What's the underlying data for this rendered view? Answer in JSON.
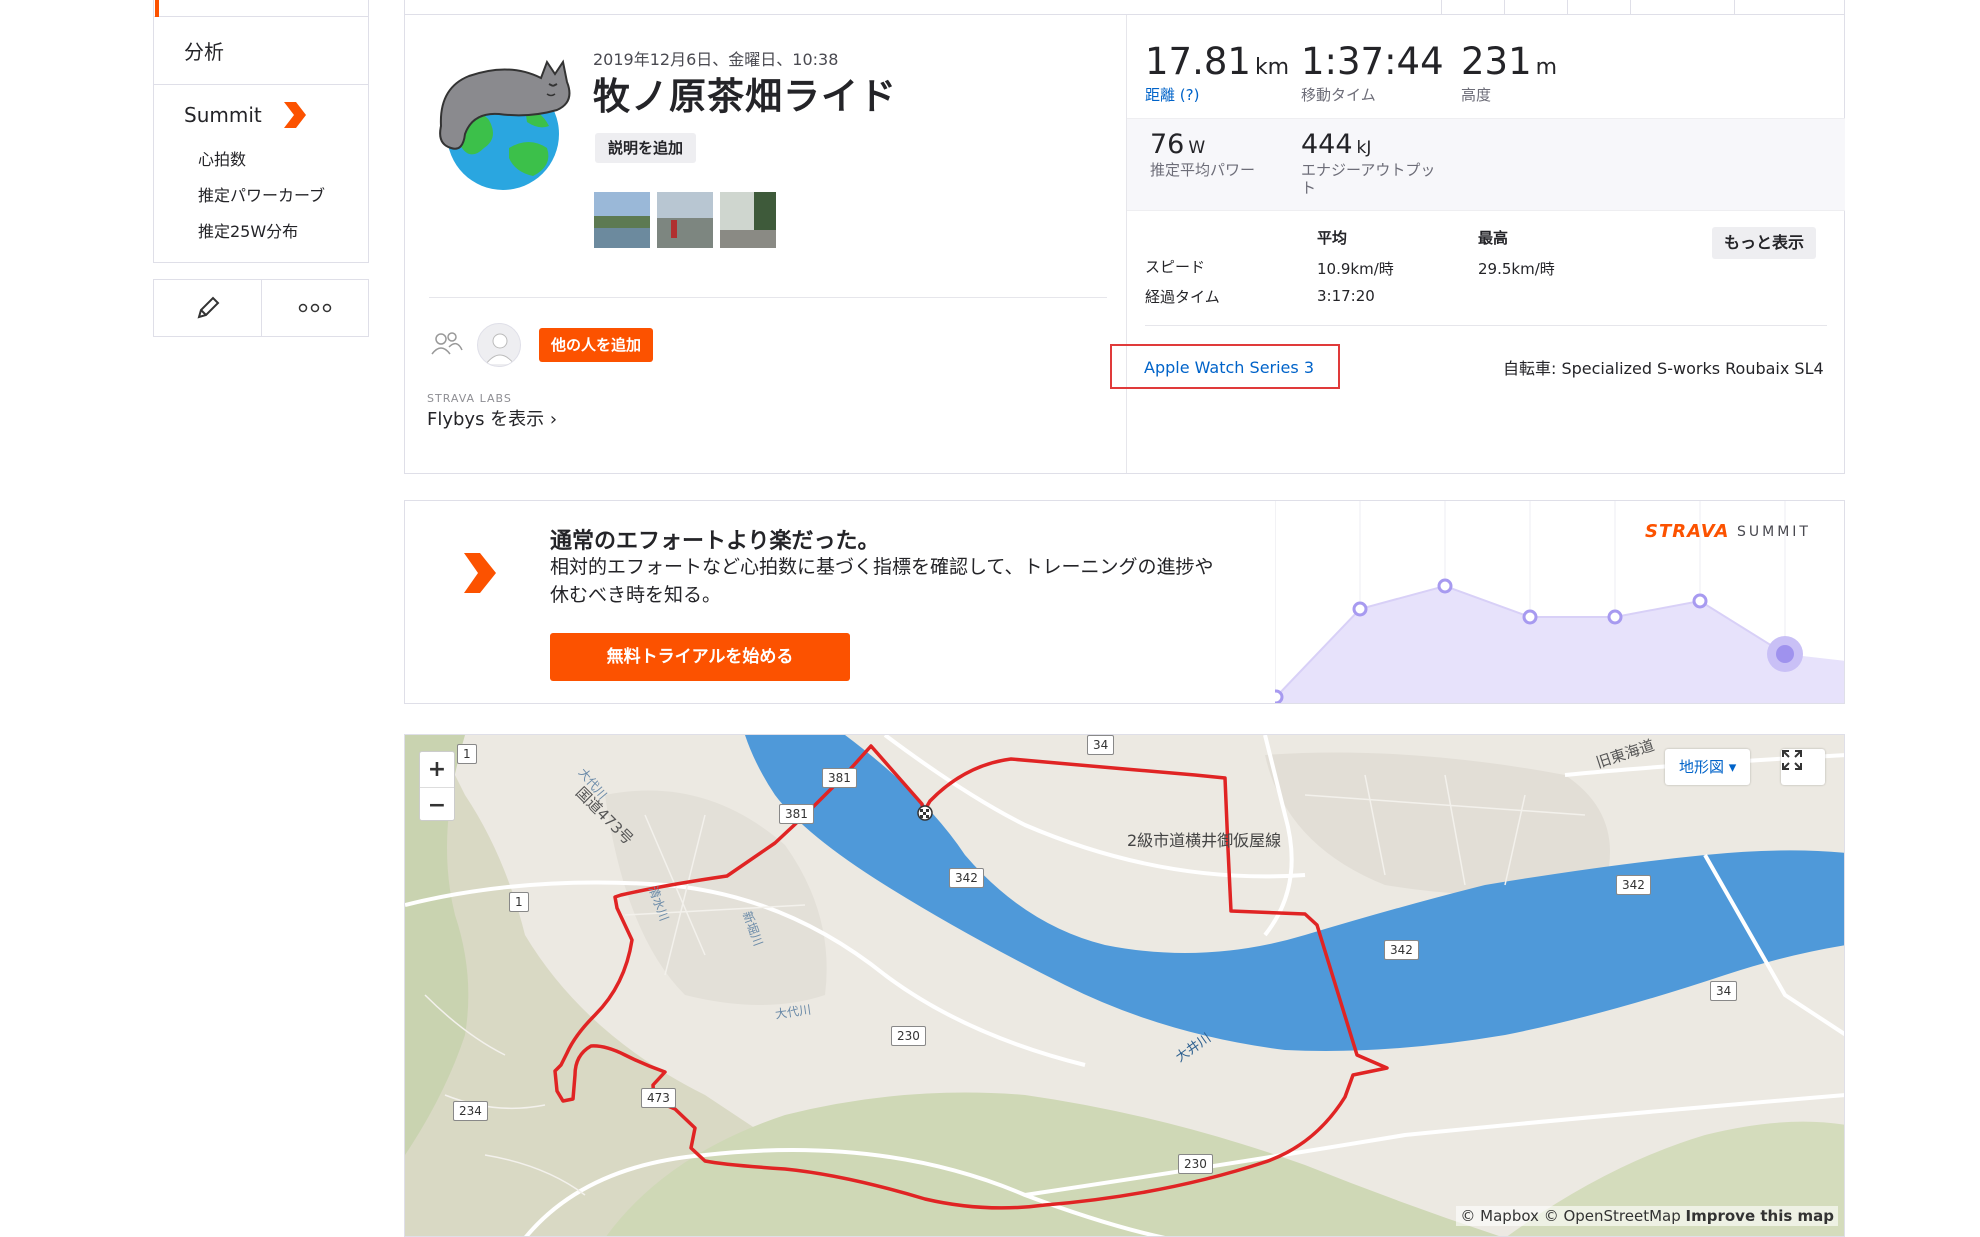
{
  "sidebar": {
    "analysis_label": "分析",
    "summit_label": "Summit",
    "sub_items": [
      "心拍数",
      "推定パワーカーブ",
      "推定25W分布"
    ],
    "colors": {
      "accent": "#fc5200"
    }
  },
  "activity": {
    "date": "2019年12月6日、金曜日、10:38",
    "title": "牧ノ原茶畑ライド",
    "add_description": "説明を追加",
    "add_others": "他の人を追加",
    "labs_label": "STRAVA LABS",
    "flybys": "Flybys を表示 ›"
  },
  "stats": {
    "distance": {
      "value": "17.81",
      "unit": "km",
      "label": "距離 (?)"
    },
    "moving_time": {
      "value": "1:37:44",
      "unit": "",
      "label": "移動タイム"
    },
    "elevation": {
      "value": "231",
      "unit": "m",
      "label": "高度"
    },
    "power": {
      "value": "76",
      "unit": "W",
      "label": "推定平均パワー"
    },
    "energy": {
      "value": "444",
      "unit": "kJ",
      "label": "エナジーアウトプット"
    },
    "table": {
      "col_avg": "平均",
      "col_max": "最高",
      "rows": [
        {
          "label": "スピード",
          "avg": "10.9km/時",
          "max": "29.5km/時"
        },
        {
          "label": "経過タイム",
          "avg": "3:17:20",
          "max": ""
        }
      ]
    },
    "more_button": "もっと表示",
    "device": "Apple Watch Series 3",
    "bike": "自転車: Specialized S-works Roubaix SL4"
  },
  "promo": {
    "title": "通常のエフォートより楽だった。",
    "body": "相対的エフォートなど心拍数に基づく指標を確認して、トレーニングの進捗や休むべき時を知る。",
    "button": "無料トライアルを始める",
    "logo": "STRAVA",
    "logo_suffix": "SUMMIT"
  },
  "map": {
    "zoom_in": "+",
    "zoom_out": "−",
    "map_type": "地形図 ▾",
    "attribution_prefix": "© Mapbox © OpenStreetMap ",
    "attribution_link": "Improve this map",
    "labels": [
      "国道473号",
      "2級市道横井御仮屋線",
      "大代川",
      "大井川",
      "旧東海道",
      "大代川",
      "清水川",
      "新堀川"
    ],
    "road_numbers": [
      "34",
      "381",
      "381",
      "342",
      "342",
      "342",
      "230",
      "230",
      "34",
      "234",
      "1",
      "1",
      "473"
    ]
  }
}
